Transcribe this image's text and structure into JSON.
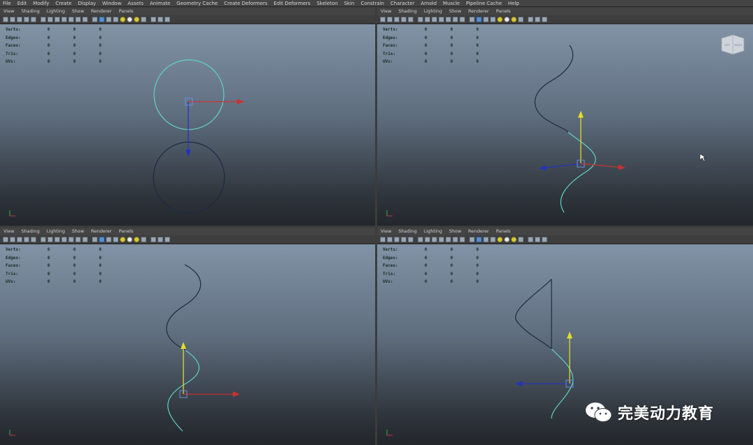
{
  "menubar": [
    "File",
    "Edit",
    "Modify",
    "Create",
    "Display",
    "Window",
    "Assets",
    "Animate",
    "Geometry Cache",
    "Create Deformers",
    "Edit Deformers",
    "Skeleton",
    "Skin",
    "Constrain",
    "Character",
    "Arnold",
    "Muscle",
    "Pipeline Cache",
    "Help"
  ],
  "panel_menu": [
    "View",
    "Shading",
    "Lighting",
    "Show",
    "Renderer",
    "Panels"
  ],
  "hud": {
    "rows": [
      {
        "label": "Verts:",
        "values": [
          "0",
          "0",
          "0"
        ]
      },
      {
        "label": "Edges:",
        "values": [
          "0",
          "0",
          "0"
        ]
      },
      {
        "label": "Faces:",
        "values": [
          "0",
          "0",
          "0"
        ]
      },
      {
        "label": "Tris:",
        "values": [
          "0",
          "0",
          "0"
        ]
      },
      {
        "label": "UVs:",
        "values": [
          "0",
          "0",
          "0"
        ]
      }
    ]
  },
  "viewcube": {
    "left_face": "LEFT",
    "right_face": "RIGHT"
  },
  "watermark": {
    "text": "完美动力教育",
    "icon": "wechat-icon"
  },
  "colors": {
    "selected_curve": "#5fd3c4",
    "dark_curve": "#1c2a44",
    "axis_x": "#c83232",
    "axis_y": "#e3dc2a",
    "axis_z": "#2534b8",
    "manip_center": "#6a8fd8"
  }
}
